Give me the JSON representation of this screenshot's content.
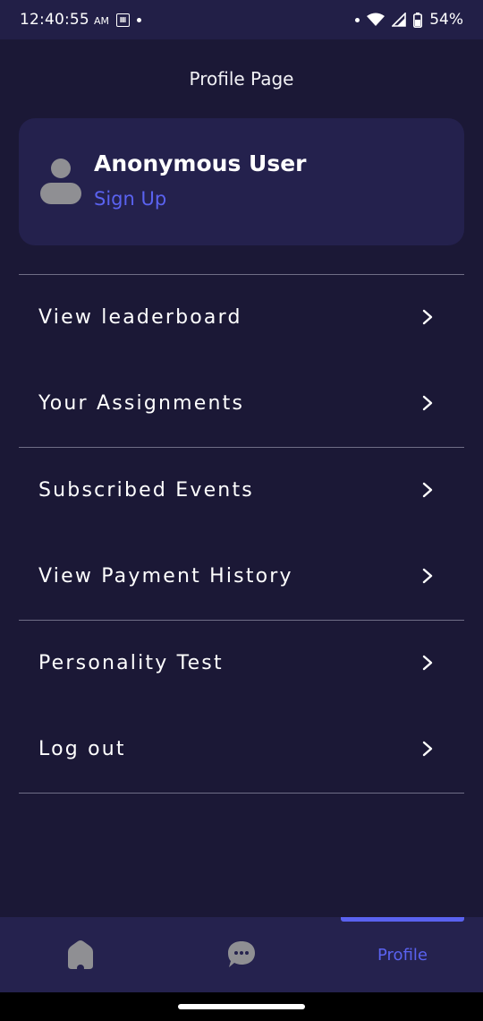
{
  "status_bar": {
    "time": "12:40:55",
    "ampm": "AM",
    "battery": "54%"
  },
  "header": {
    "title": "Profile Page"
  },
  "profile": {
    "name": "Anonymous User",
    "sign_up_label": "Sign Up"
  },
  "menu": {
    "items": [
      {
        "label": "View leaderboard"
      },
      {
        "label": "Your Assignments"
      },
      {
        "label": "Subscribed Events"
      },
      {
        "label": "View Payment History"
      },
      {
        "label": "Personality Test"
      },
      {
        "label": "Log out"
      }
    ]
  },
  "bottom_nav": {
    "profile_label": "Profile",
    "active": "profile"
  },
  "colors": {
    "background": "#1b1836",
    "card": "#24214d",
    "accent": "#5a62f0",
    "nav": "#25224e"
  }
}
